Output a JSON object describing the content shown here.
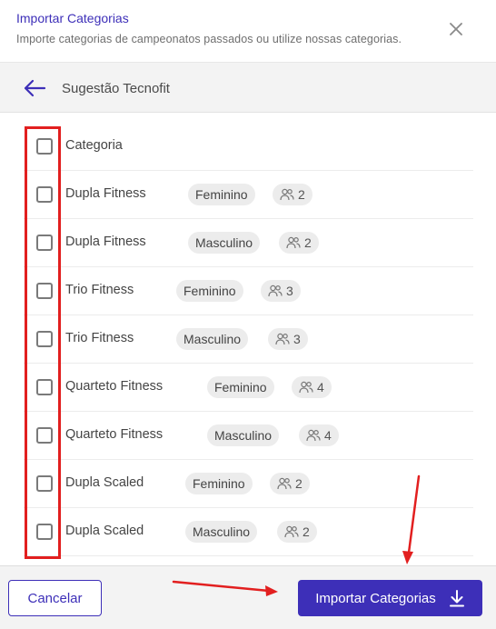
{
  "header": {
    "title": "Importar Categorias",
    "subtitle": "Importe categorias de campeonatos passados ou utilize nossas categorias."
  },
  "subheader": {
    "title": "Sugestão Tecnofit"
  },
  "list": {
    "header_label": "Categoria",
    "rows": [
      {
        "name": "Dupla Fitness",
        "gender": "Feminino",
        "size": "2"
      },
      {
        "name": "Dupla Fitness",
        "gender": "Masculino",
        "size": "2"
      },
      {
        "name": "Trio Fitness",
        "gender": "Feminino",
        "size": "3"
      },
      {
        "name": "Trio Fitness",
        "gender": "Masculino",
        "size": "3"
      },
      {
        "name": "Quarteto Fitness",
        "gender": "Feminino",
        "size": "4"
      },
      {
        "name": "Quarteto Fitness",
        "gender": "Masculino",
        "size": "4"
      },
      {
        "name": "Dupla Scaled",
        "gender": "Feminino",
        "size": "2"
      },
      {
        "name": "Dupla Scaled",
        "gender": "Masculino",
        "size": "2"
      }
    ]
  },
  "footer": {
    "cancel_label": "Cancelar",
    "import_label": "Importar Categorias"
  },
  "icons": {
    "close": "close-icon",
    "back": "arrow-left-icon",
    "group": "group-icon",
    "download": "download-icon"
  },
  "colors": {
    "brand": "#3d2fb8",
    "annotation": "#e21f1f"
  }
}
